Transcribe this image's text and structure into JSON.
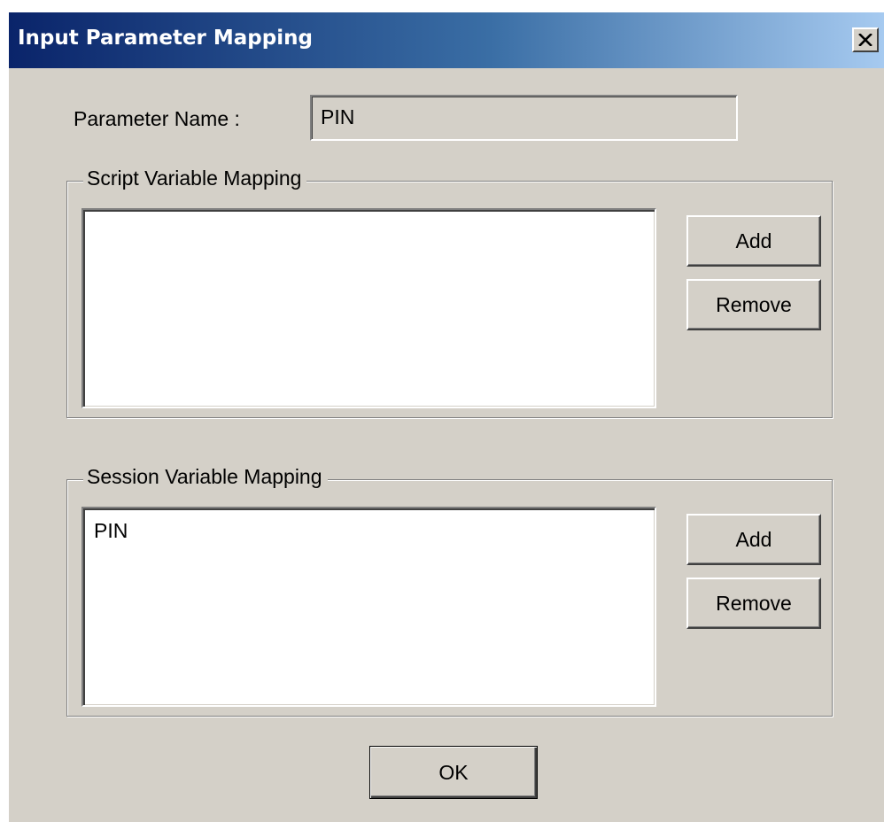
{
  "window": {
    "title": "Input Parameter Mapping",
    "close_icon": "close-icon"
  },
  "colors": {
    "title_gradient_start": "#0a246a",
    "title_gradient_end": "#a6caf0",
    "dialog_face": "#d4d0c8",
    "list_background": "#ffffff"
  },
  "parameter": {
    "label": "Parameter Name :",
    "value": "PIN"
  },
  "script_mapping": {
    "legend": "Script Variable Mapping",
    "items": [],
    "add_label": "Add",
    "remove_label": "Remove"
  },
  "session_mapping": {
    "legend": "Session Variable Mapping",
    "items": [
      "PIN"
    ],
    "add_label": "Add",
    "remove_label": "Remove"
  },
  "footer": {
    "ok_label": "OK"
  }
}
